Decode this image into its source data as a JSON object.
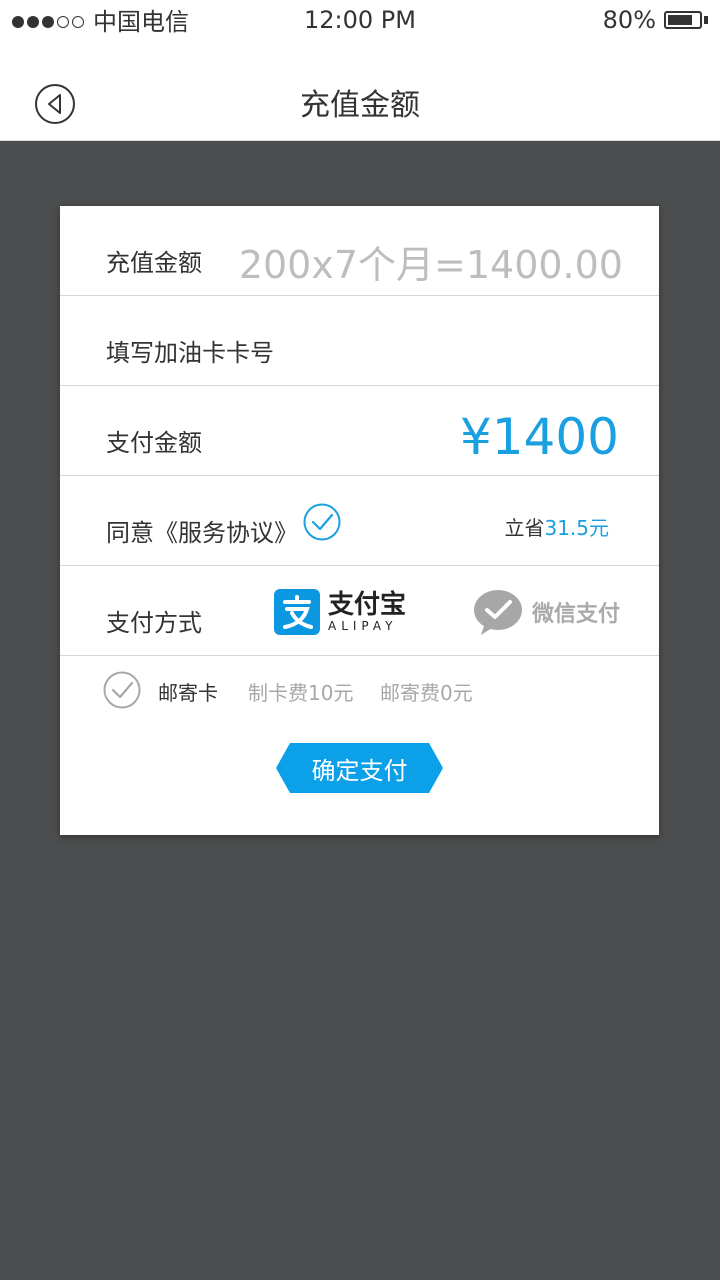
{
  "status_bar": {
    "carrier": "中国电信",
    "time": "12:00 PM",
    "battery_percent": "80%",
    "battery_level": 0.8,
    "signal_strength": 3,
    "signal_max": 5
  },
  "header": {
    "title": "充值金额",
    "back_icon": "back-circle-arrow-icon"
  },
  "form": {
    "recharge_label": "充值金额",
    "recharge_calc": "200x7个月=1400.00",
    "card_number_label": "填写加油卡卡号",
    "pay_amount_label": "支付金额",
    "pay_amount_value": "¥1400",
    "agree_text": "同意《服务协议》",
    "agree_checked": true,
    "save_prefix": "立省",
    "save_amount": "31.5元",
    "pay_method_label": "支付方式",
    "alipay_cn": "支付宝",
    "alipay_en": "ALIPAY",
    "wechat_label": "微信支付",
    "mail_card_label": "邮寄卡",
    "card_fee": "制卡费10元",
    "postage_fee": "邮寄费0元",
    "confirm_button": "确定支付"
  },
  "colors": {
    "accent": "#1aa0e0",
    "background": "#4b4d4e"
  }
}
